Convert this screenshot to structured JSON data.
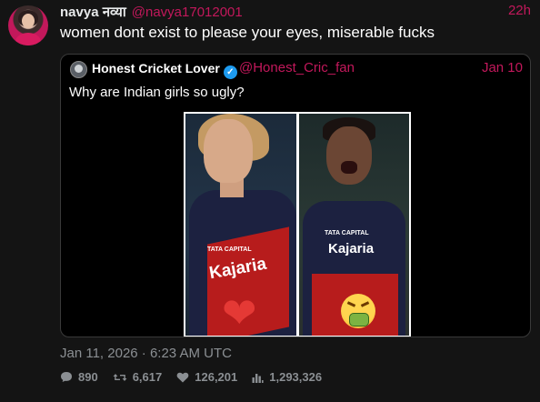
{
  "tweet": {
    "display_name": "navya नव्या",
    "handle": "@navya17012001",
    "time": "22h",
    "text": "women dont exist to please your eyes, miserable fucks",
    "posted": "Jan 11, 2026 · 6:23 AM UTC"
  },
  "quoted": {
    "display_name": "Honest Cricket Lover",
    "verified_icon": "verified-badge-icon",
    "handle": "@Honest_Cric_fan",
    "time": "Jan 10",
    "text": "Why are Indian girls so ugly?",
    "image": {
      "left_jersey_sponsor": "Kajaria",
      "left_jersey_tag": "TATA CAPITAL",
      "right_jersey_sponsor": "Kajaria",
      "right_jersey_tag": "TATA CAPITAL",
      "left_emoji": "heart-icon",
      "right_emoji": "vomiting-face-icon"
    }
  },
  "stats": {
    "replies": "890",
    "retweets": "6,617",
    "likes": "126,201",
    "views": "1,293,326"
  },
  "colors": {
    "background": "#141414",
    "accent": "#c2185b",
    "muted": "#8b8f93",
    "verified": "#1d9bf0"
  }
}
